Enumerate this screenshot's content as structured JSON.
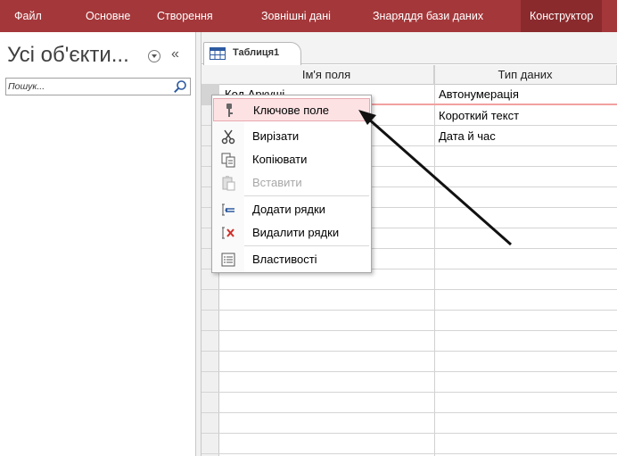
{
  "ribbon": {
    "tabs": [
      {
        "label": "Файл"
      },
      {
        "label": "Основне"
      },
      {
        "label": "Створення"
      },
      {
        "label": "Зовнішні дані"
      },
      {
        "label": "Знаряддя бази даних"
      },
      {
        "label": "Конструктор"
      }
    ],
    "active_color": "#8a2a2d",
    "color": "#a4373a"
  },
  "nav": {
    "title": "Усі об'єкти...",
    "search_placeholder": "Пошук...",
    "collapse_glyph": "«"
  },
  "document": {
    "tab_label": "Таблиця1",
    "columns": {
      "field_name": "Ім'я поля",
      "data_type": "Тип даних"
    },
    "rows": [
      {
        "field": "Код Аркуші",
        "type": "Автонумерація"
      },
      {
        "field": "",
        "type": "Короткий текст"
      },
      {
        "field": "",
        "type": "Дата й час"
      }
    ]
  },
  "context_menu": {
    "items": [
      {
        "label": "Ключове поле",
        "icon": "key-icon",
        "highlighted": true
      },
      {
        "label": "Вирізати",
        "icon": "scissors-icon"
      },
      {
        "label": "Копіювати",
        "icon": "copy-icon"
      },
      {
        "label": "Вставити",
        "icon": "paste-icon",
        "disabled": true
      },
      {
        "label": "Додати рядки",
        "icon": "insert-rows-icon"
      },
      {
        "label": "Видалити рядки",
        "icon": "delete-rows-icon"
      },
      {
        "label": "Властивості",
        "icon": "properties-icon"
      }
    ],
    "highlight_color": "#fde2e4"
  }
}
